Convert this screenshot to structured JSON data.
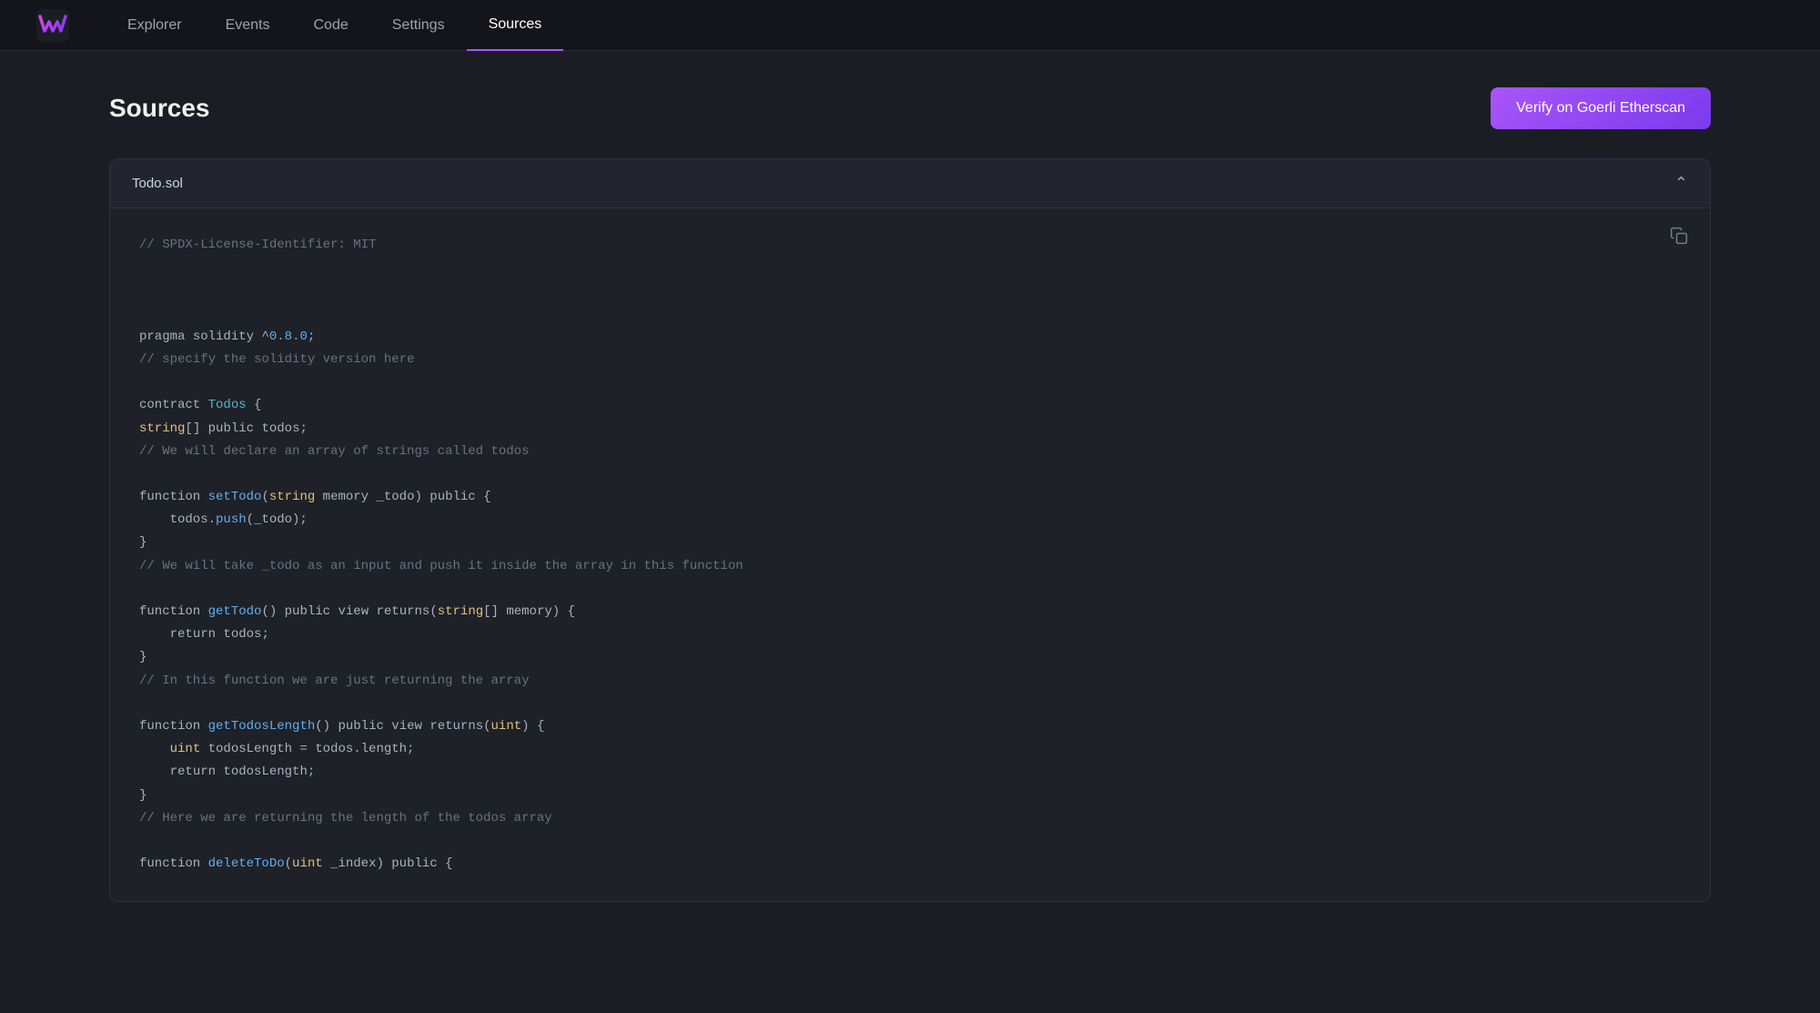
{
  "app": {
    "logo_alt": "Tenderly Logo"
  },
  "nav": {
    "links": [
      {
        "id": "explorer",
        "label": "Explorer",
        "active": false
      },
      {
        "id": "events",
        "label": "Events",
        "active": false
      },
      {
        "id": "code",
        "label": "Code",
        "active": false
      },
      {
        "id": "settings",
        "label": "Settings",
        "active": false
      },
      {
        "id": "sources",
        "label": "Sources",
        "active": true
      }
    ]
  },
  "page": {
    "title": "Sources",
    "verify_button": "Verify on Goerli Etherscan"
  },
  "file_panel": {
    "file_name": "Todo.sol",
    "chevron": "chevron up"
  }
}
